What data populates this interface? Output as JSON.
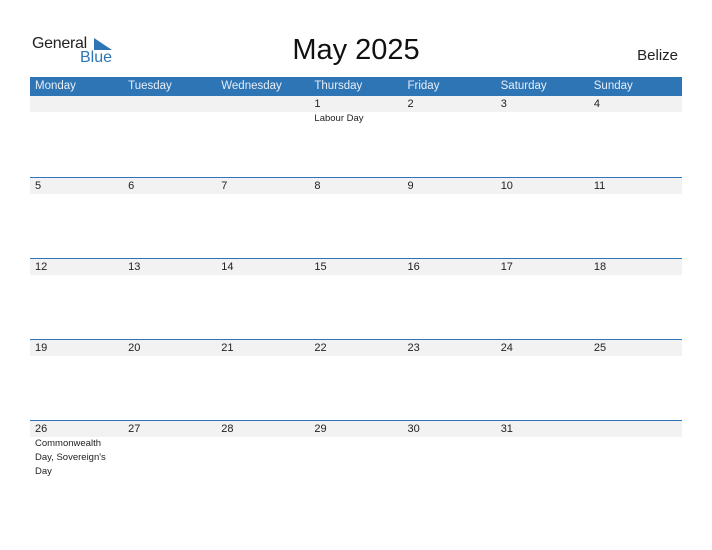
{
  "logo": {
    "part1": "General",
    "part2": "Blue"
  },
  "title": "May 2025",
  "country": "Belize",
  "weekdays": [
    "Monday",
    "Tuesday",
    "Wednesday",
    "Thursday",
    "Friday",
    "Saturday",
    "Sunday"
  ],
  "weeks": [
    [
      {
        "d": ""
      },
      {
        "d": ""
      },
      {
        "d": ""
      },
      {
        "d": "1",
        "h": "Labour Day"
      },
      {
        "d": "2"
      },
      {
        "d": "3"
      },
      {
        "d": "4"
      }
    ],
    [
      {
        "d": "5"
      },
      {
        "d": "6"
      },
      {
        "d": "7"
      },
      {
        "d": "8"
      },
      {
        "d": "9"
      },
      {
        "d": "10"
      },
      {
        "d": "11"
      }
    ],
    [
      {
        "d": "12"
      },
      {
        "d": "13"
      },
      {
        "d": "14"
      },
      {
        "d": "15"
      },
      {
        "d": "16"
      },
      {
        "d": "17"
      },
      {
        "d": "18"
      }
    ],
    [
      {
        "d": "19"
      },
      {
        "d": "20"
      },
      {
        "d": "21"
      },
      {
        "d": "22"
      },
      {
        "d": "23"
      },
      {
        "d": "24"
      },
      {
        "d": "25"
      }
    ],
    [
      {
        "d": "26",
        "h": "Commonwealth Day, Sovereign's Day"
      },
      {
        "d": "27"
      },
      {
        "d": "28"
      },
      {
        "d": "29"
      },
      {
        "d": "30"
      },
      {
        "d": "31"
      },
      {
        "d": ""
      }
    ]
  ],
  "colors": {
    "accent": "#2e75b6",
    "strip": "#f2f2f2"
  }
}
